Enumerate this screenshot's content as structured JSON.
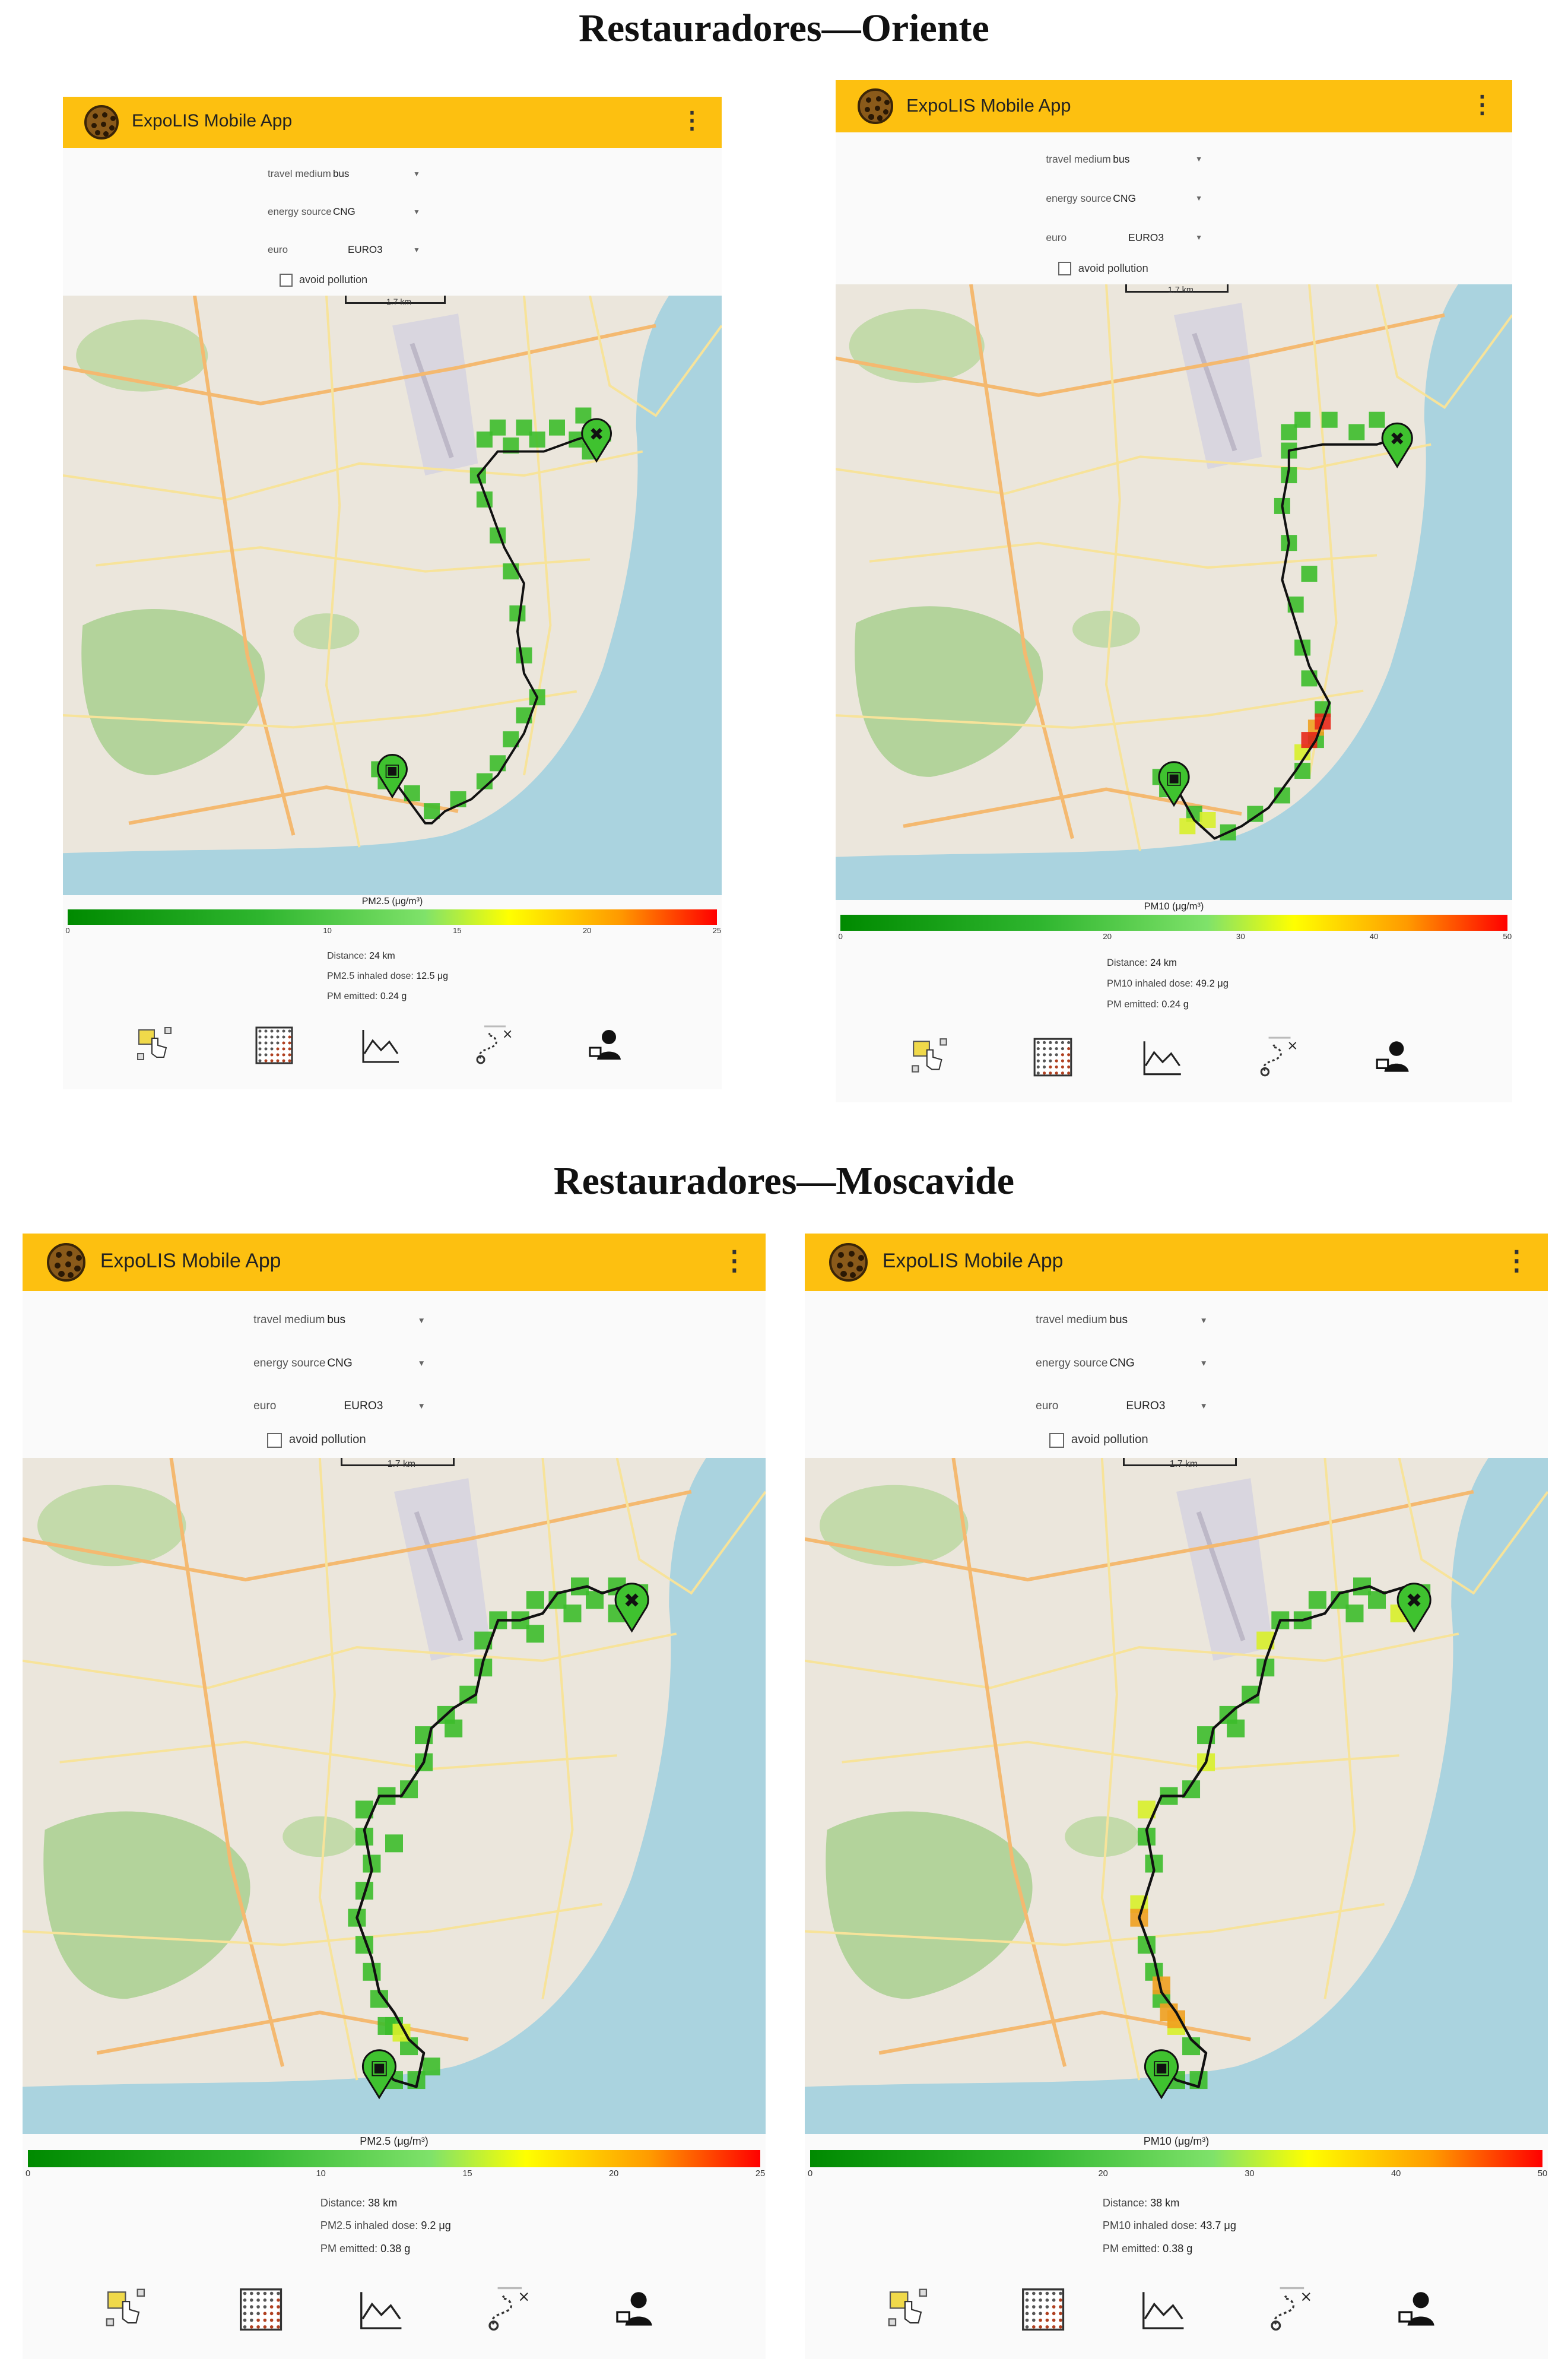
{
  "sections": [
    {
      "title": "Restauradores—Oriente"
    },
    {
      "title": "Restauradores—Moscavide"
    }
  ],
  "app": {
    "title": "ExpoLIS Mobile App",
    "menu_icon": "more-vert-icon",
    "logo_icon": "expolis-logo-icon"
  },
  "settings": {
    "travel_medium_label": "travel medium",
    "travel_medium_value": "bus",
    "energy_source_label": "energy source",
    "energy_source_value": "CNG",
    "euro_label": "euro",
    "euro_value": "EURO3",
    "avoid_pollution_label": "avoid pollution",
    "avoid_pollution_checked": false
  },
  "map": {
    "scale_label": "1.7 km",
    "start_icon": "bus-stop-marker-icon",
    "end_icon": "destination-x-marker-icon"
  },
  "stats_labels": {
    "distance": "Distance:",
    "pm_emitted": "PM emitted:"
  },
  "bottom_nav": [
    {
      "name": "touch-select-icon"
    },
    {
      "name": "pollution-grid-icon"
    },
    {
      "name": "line-chart-icon"
    },
    {
      "name": "route-icon"
    },
    {
      "name": "user-profile-icon"
    }
  ],
  "colors": {
    "appbar": "#fdc010",
    "scale": [
      "#008a00",
      "#2fb62f",
      "#7fe26a",
      "#ffff00",
      "#ff9a00",
      "#ff0000"
    ]
  },
  "panels": [
    {
      "route": "Restauradores—Oriente",
      "pollutant_label": "PM2.5 (μg/m³)",
      "scale_ticks": [
        "0",
        "10",
        "15",
        "20",
        "25"
      ],
      "distance": "24 km",
      "dose_label": "PM2.5 inhaled dose:",
      "dose": "12.5 μg",
      "pm_emitted": "0.24 g"
    },
    {
      "route": "Restauradores—Oriente",
      "pollutant_label": "PM10 (μg/m³)",
      "scale_ticks": [
        "0",
        "20",
        "30",
        "40",
        "50"
      ],
      "distance": "24 km",
      "dose_label": "PM10 inhaled dose:",
      "dose": "49.2 μg",
      "pm_emitted": "0.24 g"
    },
    {
      "route": "Restauradores—Moscavide",
      "pollutant_label": "PM2.5 (μg/m³)",
      "scale_ticks": [
        "0",
        "10",
        "15",
        "20",
        "25"
      ],
      "distance": "38 km",
      "dose_label": "PM2.5 inhaled dose:",
      "dose": "9.2 μg",
      "pm_emitted": "0.38 g"
    },
    {
      "route": "Restauradores—Moscavide",
      "pollutant_label": "PM10 (μg/m³)",
      "scale_ticks": [
        "0",
        "20",
        "30",
        "40",
        "50"
      ],
      "distance": "38 km",
      "dose_label": "PM10 inhaled dose:",
      "dose": "43.7 μg",
      "pm_emitted": "0.38 g"
    }
  ]
}
